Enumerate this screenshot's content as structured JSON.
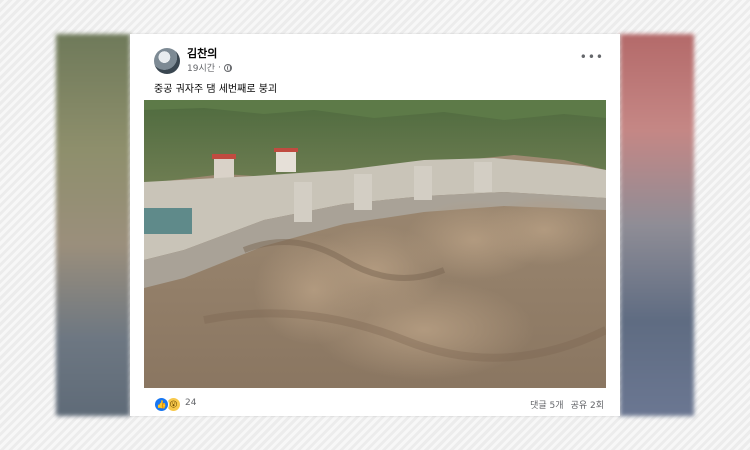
{
  "post": {
    "author": "김찬의",
    "time": "19시간",
    "text": "중공 궈자주 댐 세번째로 붕괴",
    "more": "•••",
    "reactions": {
      "icons": [
        "like-icon",
        "wow-icon"
      ],
      "count": "24"
    },
    "comments": "댓글 5개",
    "shares": "공유 2회"
  }
}
